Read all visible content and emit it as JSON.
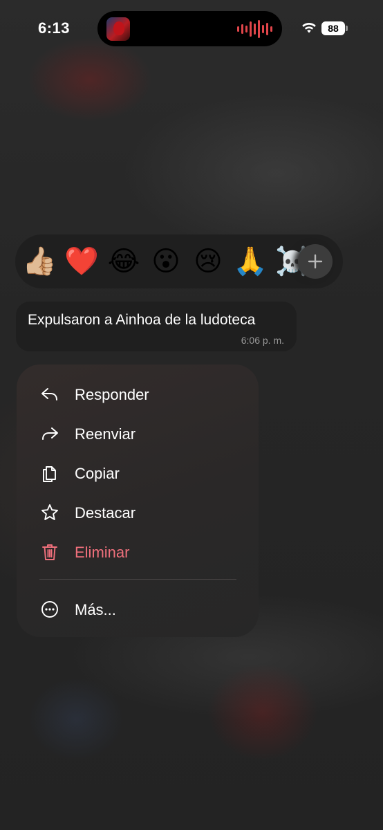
{
  "status_bar": {
    "time": "6:13",
    "battery": "88",
    "icons": [
      "app-avatar-icon",
      "audio-waveform-icon",
      "wifi-icon",
      "battery-icon"
    ]
  },
  "reactions": {
    "items": [
      {
        "emoji": "👍🏼",
        "name": "thumbs-up"
      },
      {
        "emoji": "❤️",
        "name": "red-heart"
      },
      {
        "emoji": "😂",
        "name": "tears-of-joy"
      },
      {
        "emoji": "😮",
        "name": "surprised"
      },
      {
        "emoji": "😢",
        "name": "crying"
      },
      {
        "emoji": "🙏",
        "name": "folded-hands"
      },
      {
        "emoji": "☠️",
        "name": "skull-crossbones"
      }
    ],
    "more_icon": "plus-icon"
  },
  "message": {
    "text": "Expulsaron a Ainhoa de la ludoteca",
    "time": "6:06 p. m."
  },
  "menu": {
    "items": [
      {
        "label": "Responder",
        "icon": "reply-icon"
      },
      {
        "label": "Reenviar",
        "icon": "forward-icon"
      },
      {
        "label": "Copiar",
        "icon": "copy-icon"
      },
      {
        "label": "Destacar",
        "icon": "star-icon"
      },
      {
        "label": "Eliminar",
        "icon": "trash-icon"
      },
      {
        "label": "Más...",
        "icon": "more-icon"
      }
    ]
  },
  "colors": {
    "danger": "#f0707c",
    "bubble": "#1f1f1f",
    "menu": "#2a2828"
  }
}
